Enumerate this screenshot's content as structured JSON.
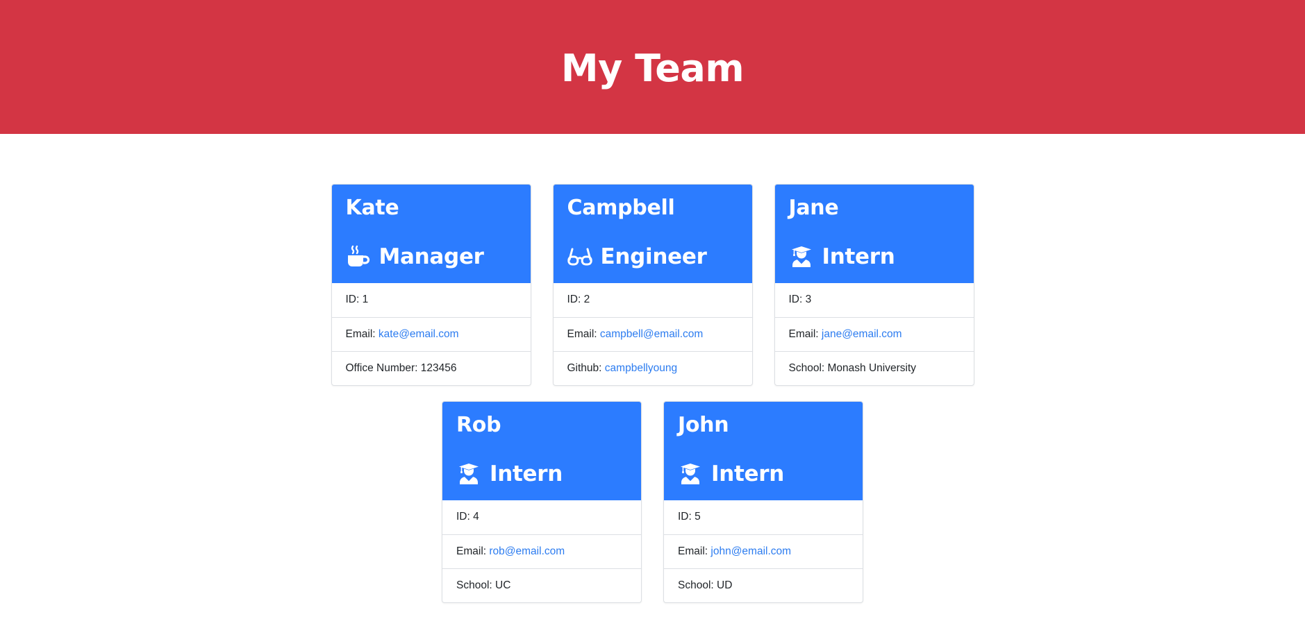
{
  "header": {
    "title": "My Team"
  },
  "colors": {
    "header_bg": "#d33544",
    "card_head_bg": "#2c7cff",
    "link": "#2c7cf0"
  },
  "cards": [
    {
      "name": "Kate",
      "role": "Manager",
      "icon": "mug-icon",
      "id_label": "ID:",
      "id": "1",
      "email_label": "Email:",
      "email": "kate@email.com",
      "extra_label": "Office Number:",
      "extra_value": "123456"
    },
    {
      "name": "Campbell",
      "role": "Engineer",
      "icon": "glasses-icon",
      "id_label": "ID:",
      "id": "2",
      "email_label": "Email:",
      "email": "campbell@email.com",
      "extra_label": "Github:",
      "extra_value": "campbellyoung"
    },
    {
      "name": "Jane",
      "role": "Intern",
      "icon": "graduate-icon",
      "id_label": "ID:",
      "id": "3",
      "email_label": "Email:",
      "email": "jane@email.com",
      "extra_label": "School:",
      "extra_value": "Monash University"
    },
    {
      "name": "Rob",
      "role": "Intern",
      "icon": "graduate-icon",
      "id_label": "ID:",
      "id": "4",
      "email_label": "Email:",
      "email": "rob@email.com",
      "extra_label": "School:",
      "extra_value": "UC"
    },
    {
      "name": "John",
      "role": "Intern",
      "icon": "graduate-icon",
      "id_label": "ID:",
      "id": "5",
      "email_label": "Email:",
      "email": "john@email.com",
      "extra_label": "School:",
      "extra_value": "UD"
    }
  ]
}
